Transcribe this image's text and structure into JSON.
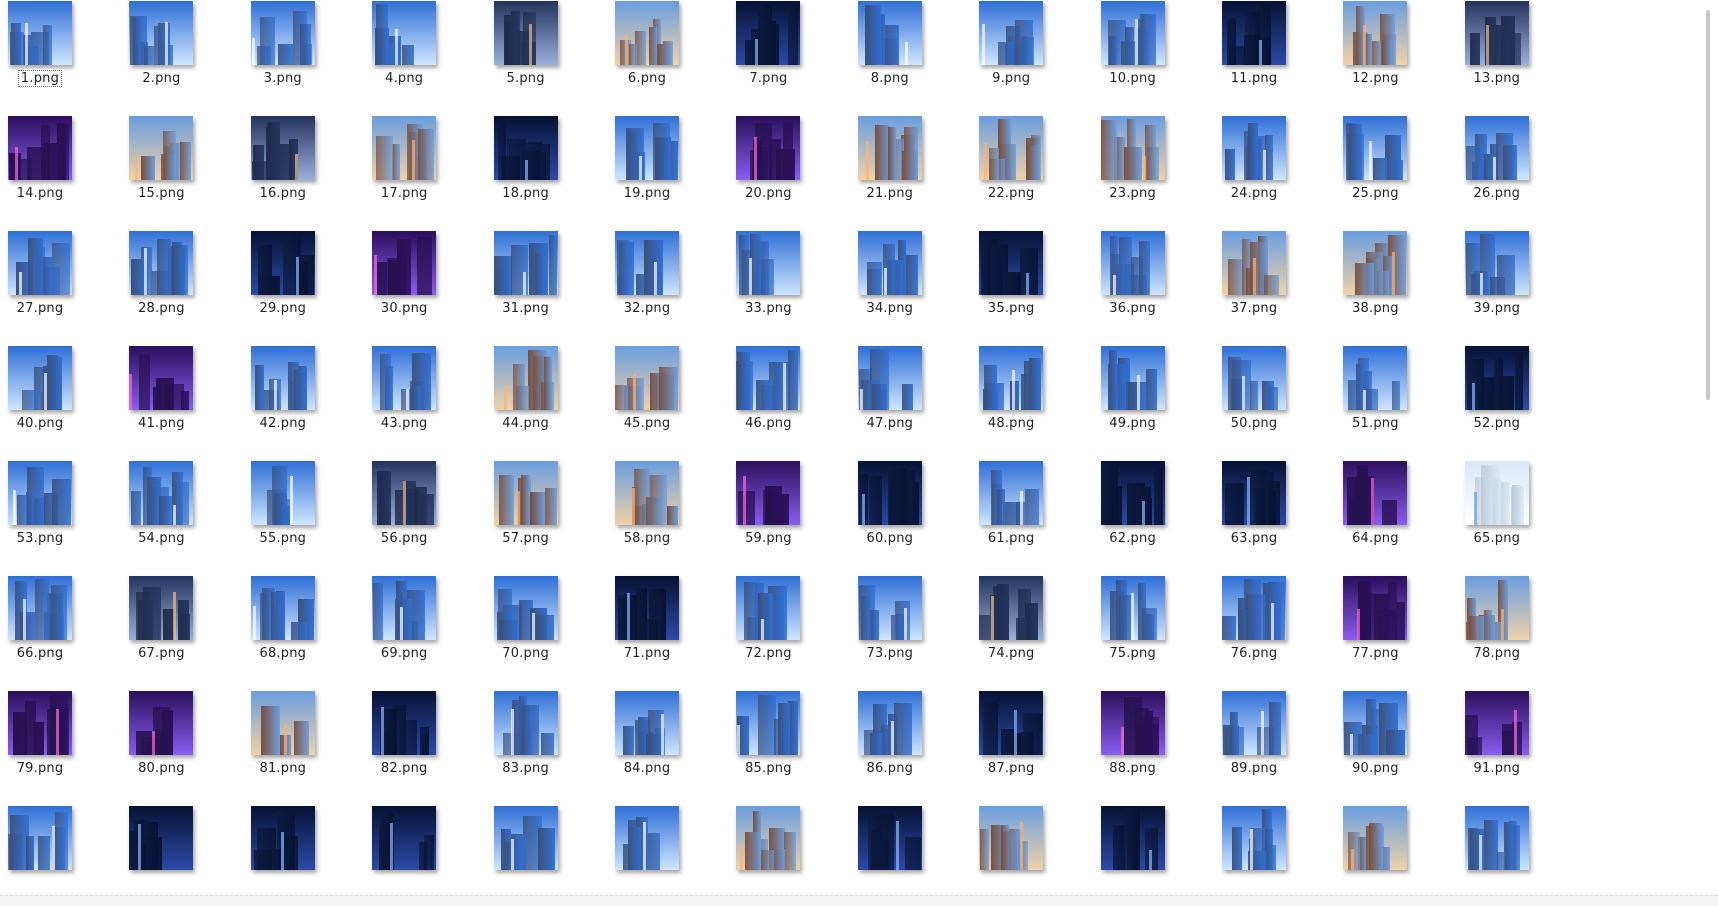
{
  "files": [
    {
      "name": "1.png",
      "theme": "day"
    },
    {
      "name": "2.png",
      "theme": "day"
    },
    {
      "name": "3.png",
      "theme": "day"
    },
    {
      "name": "4.png",
      "theme": "day"
    },
    {
      "name": "5.png",
      "theme": "dusk"
    },
    {
      "name": "6.png",
      "theme": "warm"
    },
    {
      "name": "7.png",
      "theme": "night"
    },
    {
      "name": "8.png",
      "theme": "day"
    },
    {
      "name": "9.png",
      "theme": "day"
    },
    {
      "name": "10.png",
      "theme": "day"
    },
    {
      "name": "11.png",
      "theme": "night"
    },
    {
      "name": "12.png",
      "theme": "warm"
    },
    {
      "name": "13.png",
      "theme": "dusk"
    },
    {
      "name": "14.png",
      "theme": "neon"
    },
    {
      "name": "15.png",
      "theme": "warm"
    },
    {
      "name": "16.png",
      "theme": "dusk"
    },
    {
      "name": "17.png",
      "theme": "warm"
    },
    {
      "name": "18.png",
      "theme": "night"
    },
    {
      "name": "19.png",
      "theme": "day"
    },
    {
      "name": "20.png",
      "theme": "neon"
    },
    {
      "name": "21.png",
      "theme": "warm"
    },
    {
      "name": "22.png",
      "theme": "warm"
    },
    {
      "name": "23.png",
      "theme": "warm"
    },
    {
      "name": "24.png",
      "theme": "day"
    },
    {
      "name": "25.png",
      "theme": "day"
    },
    {
      "name": "26.png",
      "theme": "day"
    },
    {
      "name": "27.png",
      "theme": "day"
    },
    {
      "name": "28.png",
      "theme": "day"
    },
    {
      "name": "29.png",
      "theme": "night"
    },
    {
      "name": "30.png",
      "theme": "neon"
    },
    {
      "name": "31.png",
      "theme": "day"
    },
    {
      "name": "32.png",
      "theme": "day"
    },
    {
      "name": "33.png",
      "theme": "day"
    },
    {
      "name": "34.png",
      "theme": "day"
    },
    {
      "name": "35.png",
      "theme": "night"
    },
    {
      "name": "36.png",
      "theme": "day"
    },
    {
      "name": "37.png",
      "theme": "warm"
    },
    {
      "name": "38.png",
      "theme": "warm"
    },
    {
      "name": "39.png",
      "theme": "day"
    },
    {
      "name": "40.png",
      "theme": "day"
    },
    {
      "name": "41.png",
      "theme": "neon"
    },
    {
      "name": "42.png",
      "theme": "day"
    },
    {
      "name": "43.png",
      "theme": "day"
    },
    {
      "name": "44.png",
      "theme": "warm"
    },
    {
      "name": "45.png",
      "theme": "warm"
    },
    {
      "name": "46.png",
      "theme": "day"
    },
    {
      "name": "47.png",
      "theme": "day"
    },
    {
      "name": "48.png",
      "theme": "day"
    },
    {
      "name": "49.png",
      "theme": "day"
    },
    {
      "name": "50.png",
      "theme": "day"
    },
    {
      "name": "51.png",
      "theme": "day"
    },
    {
      "name": "52.png",
      "theme": "night"
    },
    {
      "name": "53.png",
      "theme": "day"
    },
    {
      "name": "54.png",
      "theme": "day"
    },
    {
      "name": "55.png",
      "theme": "day"
    },
    {
      "name": "56.png",
      "theme": "dusk"
    },
    {
      "name": "57.png",
      "theme": "warm"
    },
    {
      "name": "58.png",
      "theme": "warm"
    },
    {
      "name": "59.png",
      "theme": "neon"
    },
    {
      "name": "60.png",
      "theme": "night"
    },
    {
      "name": "61.png",
      "theme": "day"
    },
    {
      "name": "62.png",
      "theme": "night"
    },
    {
      "name": "63.png",
      "theme": "night"
    },
    {
      "name": "64.png",
      "theme": "neon"
    },
    {
      "name": "65.png",
      "theme": "light"
    },
    {
      "name": "66.png",
      "theme": "day"
    },
    {
      "name": "67.png",
      "theme": "dusk"
    },
    {
      "name": "68.png",
      "theme": "day"
    },
    {
      "name": "69.png",
      "theme": "day"
    },
    {
      "name": "70.png",
      "theme": "day"
    },
    {
      "name": "71.png",
      "theme": "night"
    },
    {
      "name": "72.png",
      "theme": "day"
    },
    {
      "name": "73.png",
      "theme": "day"
    },
    {
      "name": "74.png",
      "theme": "dusk"
    },
    {
      "name": "75.png",
      "theme": "day"
    },
    {
      "name": "76.png",
      "theme": "day"
    },
    {
      "name": "77.png",
      "theme": "neon"
    },
    {
      "name": "78.png",
      "theme": "warm"
    },
    {
      "name": "79.png",
      "theme": "neon"
    },
    {
      "name": "80.png",
      "theme": "neon"
    },
    {
      "name": "81.png",
      "theme": "warm"
    },
    {
      "name": "82.png",
      "theme": "night"
    },
    {
      "name": "83.png",
      "theme": "day"
    },
    {
      "name": "84.png",
      "theme": "day"
    },
    {
      "name": "85.png",
      "theme": "day"
    },
    {
      "name": "86.png",
      "theme": "day"
    },
    {
      "name": "87.png",
      "theme": "night"
    },
    {
      "name": "88.png",
      "theme": "neon"
    },
    {
      "name": "89.png",
      "theme": "day"
    },
    {
      "name": "90.png",
      "theme": "day"
    },
    {
      "name": "91.png",
      "theme": "neon"
    },
    {
      "name": "",
      "theme": "day"
    },
    {
      "name": "",
      "theme": "night"
    },
    {
      "name": "",
      "theme": "night"
    },
    {
      "name": "",
      "theme": "night"
    },
    {
      "name": "",
      "theme": "day"
    },
    {
      "name": "",
      "theme": "day"
    },
    {
      "name": "",
      "theme": "warm"
    },
    {
      "name": "",
      "theme": "night"
    },
    {
      "name": "",
      "theme": "warm"
    },
    {
      "name": "",
      "theme": "night"
    },
    {
      "name": "",
      "theme": "day"
    },
    {
      "name": "",
      "theme": "warm"
    },
    {
      "name": "",
      "theme": "day"
    }
  ],
  "selected_index": 0,
  "palettes": {
    "day": {
      "sky_top": "#2f6fd6",
      "sky_bottom": "#cfe6ff",
      "building": "#3a4f78",
      "accent": "#ffffff"
    },
    "night": {
      "sky_top": "#061233",
      "sky_bottom": "#2b4aa8",
      "building": "#0c1a3e",
      "accent": "#8fb8ff"
    },
    "dusk": {
      "sky_top": "#23335e",
      "sky_bottom": "#9ab0d8",
      "building": "#1f2b4a",
      "accent": "#e9c08a"
    },
    "warm": {
      "sky_top": "#6a9ee0",
      "sky_bottom": "#f0d2a8",
      "building": "#7a4a33",
      "accent": "#ffb36b"
    },
    "neon": {
      "sky_top": "#2a0f5c",
      "sky_bottom": "#8a5cf0",
      "building": "#24134a",
      "accent": "#ff6ad5"
    },
    "light": {
      "sky_top": "#d9e8f5",
      "sky_bottom": "#ffffff",
      "building": "#b7c6d8",
      "accent": "#6aa0d8"
    }
  }
}
